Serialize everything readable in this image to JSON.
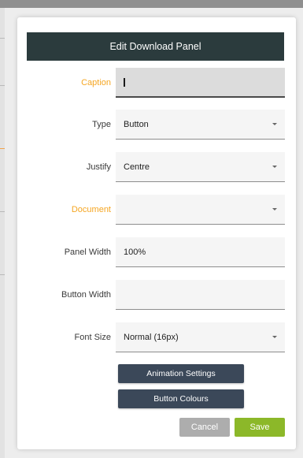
{
  "dialog": {
    "title": "Edit Download Panel"
  },
  "fields": {
    "caption": {
      "label": "Caption",
      "value": ""
    },
    "type": {
      "label": "Type",
      "value": "Button"
    },
    "justify": {
      "label": "Justify",
      "value": "Centre"
    },
    "document": {
      "label": "Document",
      "value": ""
    },
    "panel_width": {
      "label": "Panel Width",
      "value": "100%"
    },
    "button_width": {
      "label": "Button Width",
      "value": ""
    },
    "font_size": {
      "label": "Font Size",
      "value": "Normal (16px)"
    }
  },
  "actions": {
    "animation_settings": "Animation Settings",
    "button_colours": "Button Colours",
    "cancel": "Cancel",
    "save": "Save"
  },
  "colors": {
    "header_bg": "#2b3b3d",
    "required_label": "#f5a623",
    "secondary_button": "#3b4859",
    "cancel_button": "#adadad",
    "save_button": "#8cb829"
  },
  "icons": {
    "dropdown": "caret-down"
  }
}
